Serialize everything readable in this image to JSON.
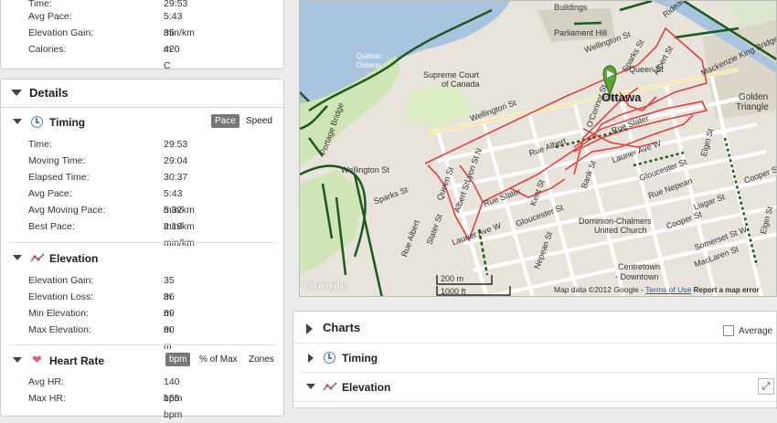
{
  "summary": {
    "time_label": "Time:",
    "time_value": "29:53",
    "avg_pace_label": "Avg Pace:",
    "avg_pace_value": "5:43 min/km",
    "elev_gain_label": "Elevation Gain:",
    "elev_gain_value": "35 m",
    "calories_label": "Calories:",
    "calories_value": "420 C"
  },
  "details": {
    "title": "Details",
    "timing": {
      "title": "Timing",
      "toggle_selected": "Pace",
      "toggle_other": "Speed",
      "rows": [
        {
          "label": "Time:",
          "value": "29:53"
        },
        {
          "label": "Moving Time:",
          "value": "29:04"
        },
        {
          "label": "Elapsed Time:",
          "value": "30:37"
        },
        {
          "label": "Avg Pace:",
          "value": "5:43 min/km"
        },
        {
          "label": "Avg Moving Pace:",
          "value": "5:32 min/km"
        },
        {
          "label": "Best Pace:",
          "value": "2:18 min/km"
        }
      ]
    },
    "elevation": {
      "title": "Elevation",
      "rows": [
        {
          "label": "Elevation Gain:",
          "value": "35 m"
        },
        {
          "label": "Elevation Loss:",
          "value": "36 m"
        },
        {
          "label": "Min Elevation:",
          "value": "69 m"
        },
        {
          "label": "Max Elevation:",
          "value": "80 m"
        }
      ]
    },
    "heart_rate": {
      "title": "Heart Rate",
      "toggle_selected": "bpm",
      "toggle_pct": "% of Max",
      "toggle_zones": "Zones",
      "rows": [
        {
          "label": "Avg HR:",
          "value": "140 bpm"
        },
        {
          "label": "Max HR:",
          "value": "155 bpm"
        }
      ]
    }
  },
  "map": {
    "labels": {
      "buildings": "Buildings",
      "parliament": "Parliament Hill",
      "quebec": "Québec",
      "ontario": "Ontario",
      "supreme": "Supreme Court",
      "of_canada": "of Canada",
      "ottawa": "Ottawa",
      "golden": "Golden",
      "triangle": "Triangle",
      "wellington1": "Wellington St",
      "wellington2": "Wellington St",
      "wellington3": "Wellington St",
      "queen1": "Queen St",
      "queen2": "Queen St",
      "sparks1": "Sparks St",
      "sparks2": "Sparks St",
      "albert1": "Albert St",
      "albert2": "Albert St",
      "albert3": "Rue Albert",
      "albert4": "Rue Albert",
      "slater1": "Rue Slater",
      "slater2": "Slater St",
      "slater3": "Rue Slater",
      "laurier1": "Laurier Ave W",
      "laurier2": "Laurier Ave W",
      "gloucester1": "Gloucester St",
      "gloucester2": "Gloucester St",
      "nepean1": "Nepean St",
      "nepean2": "Rue Nepean",
      "lisgar": "Lisgar St",
      "cooper1": "Cooper St",
      "cooper2": "Cooper St",
      "somerset": "Somerset St W",
      "maclaren": "MacLaren St",
      "elgin1": "Elgin St",
      "elgin2": "Elgin St",
      "kent": "Kent St",
      "bank": "Bank St",
      "lyon": "Lyon St N",
      "oconnor": "O'Connor St",
      "mackenzie": "Mackenzie King Bridge",
      "rideau": "Rideau",
      "dominion1": "Dominion-Chalmers",
      "dominion2": "United Church",
      "centretown1": "Centretown",
      "centretown2": "- Downtown",
      "portage": "Portage Bridge",
      "scale_m": "200 m",
      "scale_ft": "1000 ft",
      "google": "Google",
      "mapdata": "Map data ©2012 Google -",
      "terms": "Terms of Use",
      "report": "Report a map error"
    }
  },
  "charts": {
    "title": "Charts",
    "average_label": "Average",
    "timing_label": "Timing",
    "elevation_label": "Elevation"
  },
  "colors": {
    "route": "#e03030",
    "water": "#a9c4de",
    "park": "#cfe5b5",
    "trail": "#1a5a1a"
  }
}
